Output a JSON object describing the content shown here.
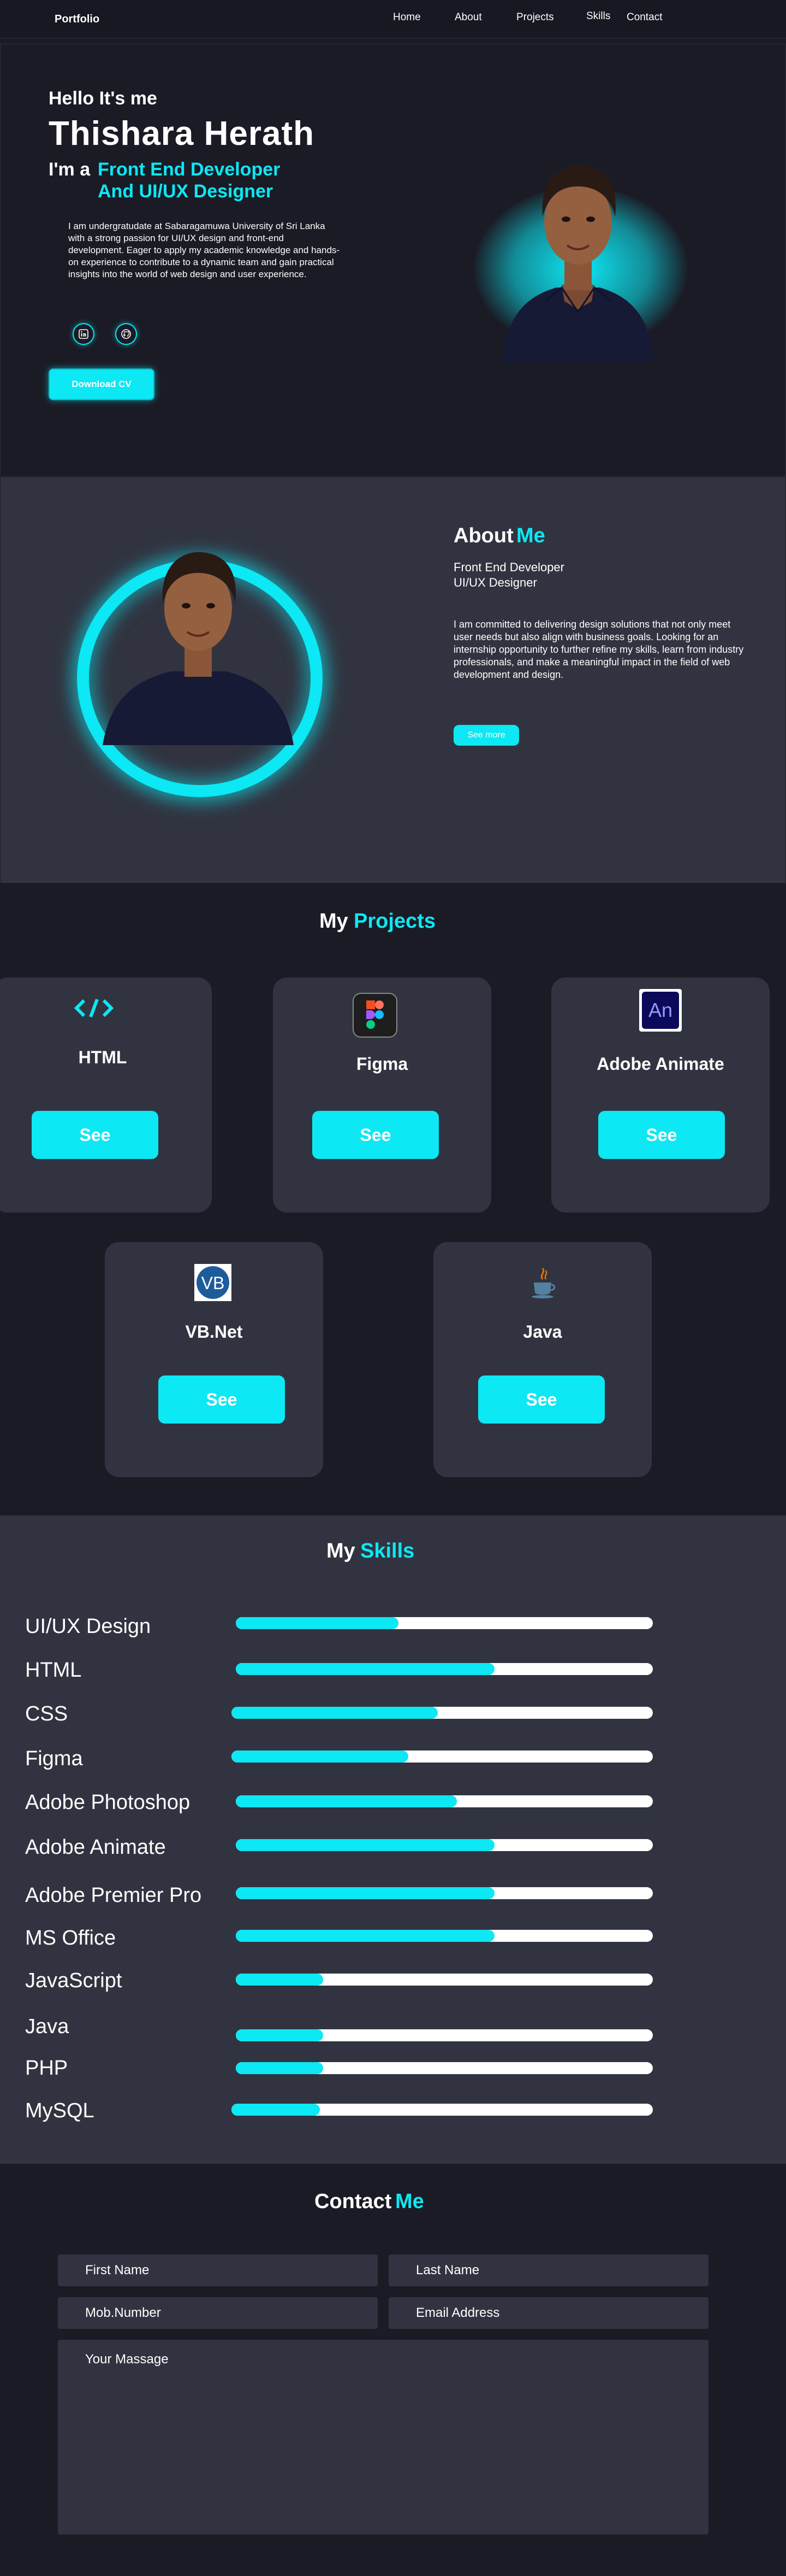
{
  "nav": {
    "brand": "Portfolio",
    "links": [
      "Home",
      "About",
      "Projects",
      "Skills",
      "Contact"
    ]
  },
  "hero": {
    "greeting": "Hello It's me",
    "name": "Thishara Herath",
    "im_prefix": "I'm a",
    "role_line1": "Front End Developer",
    "role_line2": "And UI/UX Designer",
    "description": "I am undergratudate at Sabaragamuwa University of Sri Lanka with a strong passion for UI/UX design and front-end development. Eager to apply my academic knowledge and hands-on experience to contribute to a dynamic team and gain practical insights into the world of web design and user experience.",
    "social_icons": [
      "linkedin-icon",
      "github-icon"
    ],
    "download_label": "Download CV"
  },
  "about": {
    "title_a": "About",
    "title_b": "Me",
    "sub1": "Front End Developer",
    "sub2": "UI/UX Designer",
    "description": "I am committed to delivering design solutions that not only meet user needs but also align with business goals. Looking for an internship opportunity to further refine my skills, learn from industry professionals, and make a meaningful impact in the field of web development and design.",
    "see_more": "See more"
  },
  "projects": {
    "title_a": "My",
    "title_b": "Projects",
    "items": [
      {
        "name": "HTML",
        "button": "See",
        "icon": "html-code-icon"
      },
      {
        "name": "Figma",
        "button": "See",
        "icon": "figma-icon"
      },
      {
        "name": "Adobe Animate",
        "button": "See",
        "icon": "adobe-animate-icon"
      },
      {
        "name": "VB.Net",
        "button": "See",
        "icon": "vb-icon"
      },
      {
        "name": "Java",
        "button": "See",
        "icon": "java-icon"
      }
    ]
  },
  "skills": {
    "title_a": "My",
    "title_b": "Skills",
    "items": [
      {
        "label": "UI/UX Design",
        "level": 0.39
      },
      {
        "label": "HTML",
        "level": 0.62
      },
      {
        "label": "CSS",
        "level": 0.49
      },
      {
        "label": "Figma",
        "level": 0.42
      },
      {
        "label": "Adobe Photoshop",
        "level": 0.53
      },
      {
        "label": "Adobe Animate",
        "level": 0.62
      },
      {
        "label": "Adobe Premier Pro",
        "level": 0.62
      },
      {
        "label": "MS Office",
        "level": 0.62
      },
      {
        "label": "JavaScript",
        "level": 0.21
      },
      {
        "label": "Java",
        "level": 0.21
      },
      {
        "label": "PHP",
        "level": 0.21
      },
      {
        "label": "MySQL",
        "level": 0.21
      }
    ]
  },
  "contact": {
    "title_a": "Contact",
    "title_b": "Me",
    "first_name": "First Name",
    "last_name": "Last Name",
    "mobile": "Mob.Number",
    "email": "Email Address",
    "message": "Your Massage"
  },
  "colors": {
    "accent": "#0ce8f4",
    "background": "#1a1b25",
    "panel": "#313440"
  }
}
